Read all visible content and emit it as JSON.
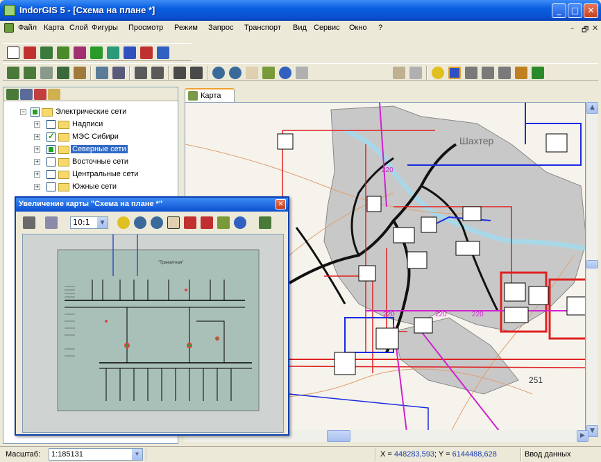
{
  "window": {
    "title": "IndorGIS 5 - [Схема на плане *]"
  },
  "menu": [
    "Файл",
    "Карта",
    "Слой",
    "Фигуры",
    "Просмотр",
    "Режим",
    "Запрос",
    "Транспорт",
    "Вид",
    "Сервис",
    "Окно",
    "?"
  ],
  "mdi_controls": [
    "–",
    "🗗",
    "✕"
  ],
  "toolbar_icons": [
    "new-icon",
    "tool-icon",
    "layer-icon",
    "settings-icon",
    "book-icon",
    "arrow-icon",
    "doc-icon",
    "chart-icon",
    "edit-icon"
  ],
  "tree": {
    "root": {
      "label": "Электрические сети"
    },
    "items": [
      {
        "label": "Надписи",
        "checked": "off"
      },
      {
        "label": "МЭС Сибири",
        "checked": "on"
      },
      {
        "label": "Северные сети",
        "checked": "partial",
        "selected": true
      },
      {
        "label": "Восточные сети",
        "checked": "off"
      },
      {
        "label": "Центральные сети",
        "checked": "off"
      },
      {
        "label": "Южные сети",
        "checked": "off"
      }
    ]
  },
  "map_tab": {
    "label": "Карта"
  },
  "map_labels": {
    "town": "Шахтер",
    "line1": "220",
    "line2": "220",
    "line3": "220",
    "line4": "220",
    "pt": "251"
  },
  "zoom_window": {
    "title": "Увеличение карты \"Схема на плане *\"",
    "zoom_value": "10:1",
    "sheet_title": "\"Транзитная\""
  },
  "statusbar": {
    "scale_label": "Масштаб:",
    "scale_value": "1:185131",
    "x_label": "X = ",
    "x_value": "448283,593",
    "y_label": "; Y = ",
    "y_value": "6144488,628",
    "mode": "Ввод данных"
  },
  "colors": {
    "titlebar": "#0b4fd0",
    "selection": "#316ac5",
    "map_red": "#e02020",
    "map_blue": "#1a2ae0",
    "map_magenta": "#d020d0"
  }
}
